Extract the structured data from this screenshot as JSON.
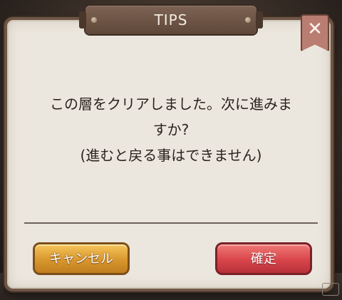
{
  "dialog": {
    "title": "TIPS",
    "close_label": "✕",
    "message_lines": [
      "この層をクリアしました。次に進みま",
      "すか?",
      "(進むと戻る事はできません)"
    ],
    "cancel_label": "キャンセル",
    "confirm_label": "確定"
  },
  "colors": {
    "frame": "#6e5646",
    "panel": "#ece7de",
    "cancel_button": "#d8972e",
    "confirm_button": "#d8454a",
    "close_button": "#b97d72"
  }
}
